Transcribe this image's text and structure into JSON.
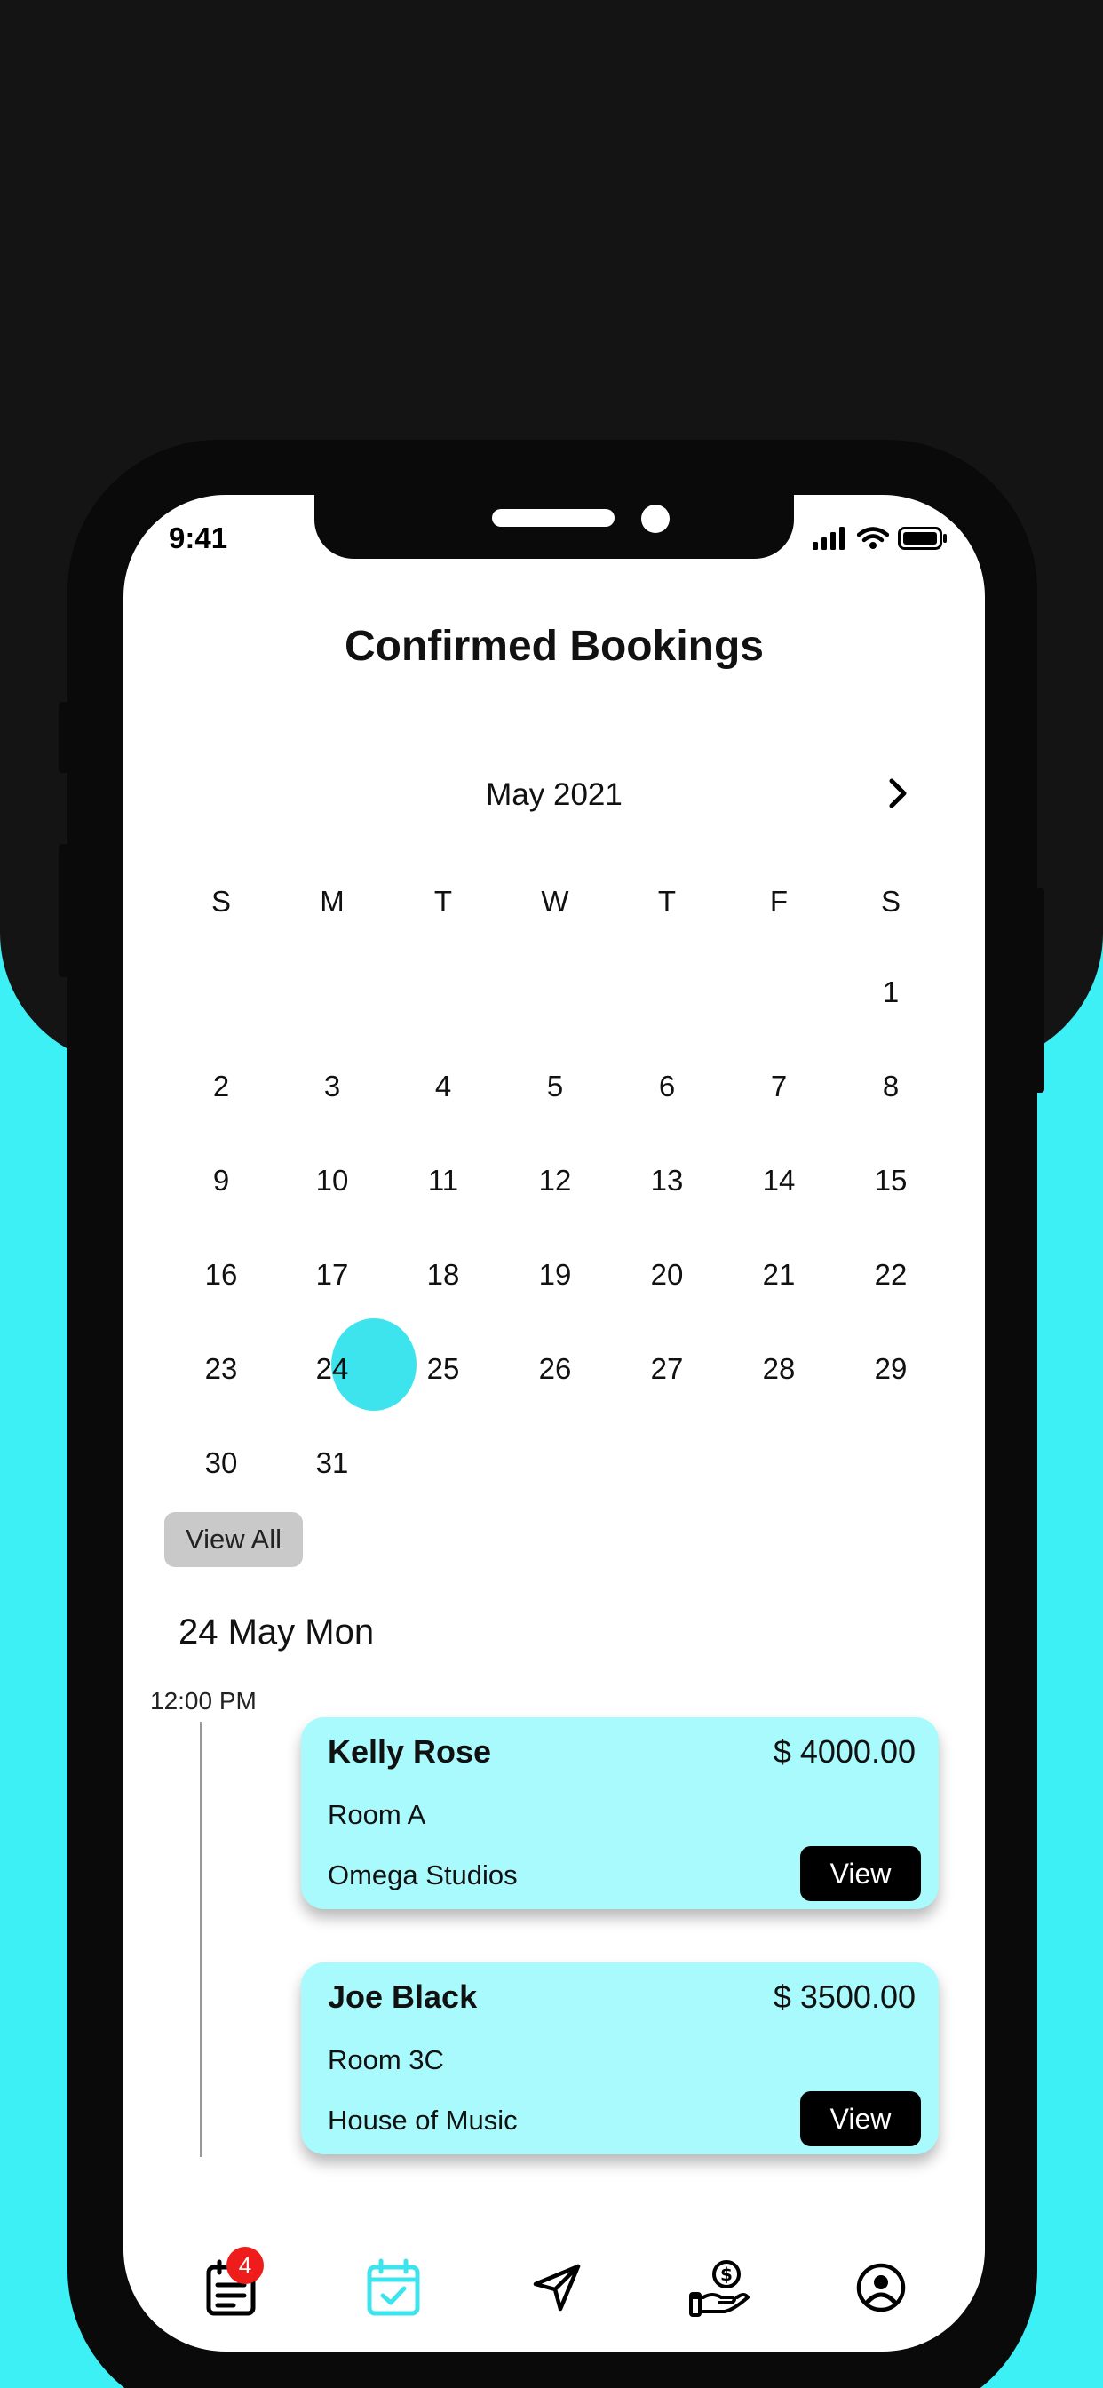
{
  "status_bar": {
    "time": "9:41"
  },
  "page": {
    "title": "Confirmed Bookings"
  },
  "calendar": {
    "month_label": "May 2021",
    "weekdays": [
      "S",
      "M",
      "T",
      "W",
      "T",
      "F",
      "S"
    ],
    "first_weekday_index": 6,
    "days_in_month": 31,
    "selected_day": 24,
    "selected_color": "#3DE4EE",
    "view_all_label": "View All"
  },
  "schedule": {
    "date_heading": "24 May Mon",
    "time_label": "12:00 PM",
    "bookings": [
      {
        "name": "Kelly Rose",
        "price": "$ 4000.00",
        "room": "Room A",
        "studio": "Omega Studios",
        "view_label": "View"
      },
      {
        "name": "Joe Black",
        "price": "$ 3500.00",
        "room": "Room 3C",
        "studio": "House of Music",
        "view_label": "View"
      }
    ]
  },
  "tab_bar": {
    "tabs": [
      {
        "icon": "bookings-list-icon",
        "active": false,
        "badge": "4"
      },
      {
        "icon": "calendar-check-icon",
        "active": true
      },
      {
        "icon": "send-icon",
        "active": false
      },
      {
        "icon": "payment-hand-icon",
        "active": false
      },
      {
        "icon": "profile-icon",
        "active": false
      }
    ],
    "active_color": "#3DE4EE"
  },
  "colors": {
    "background_top": "#141414",
    "background_accent": "#3DF0F5",
    "card": "#A9FAFC",
    "badge": "#ef1c1c"
  }
}
